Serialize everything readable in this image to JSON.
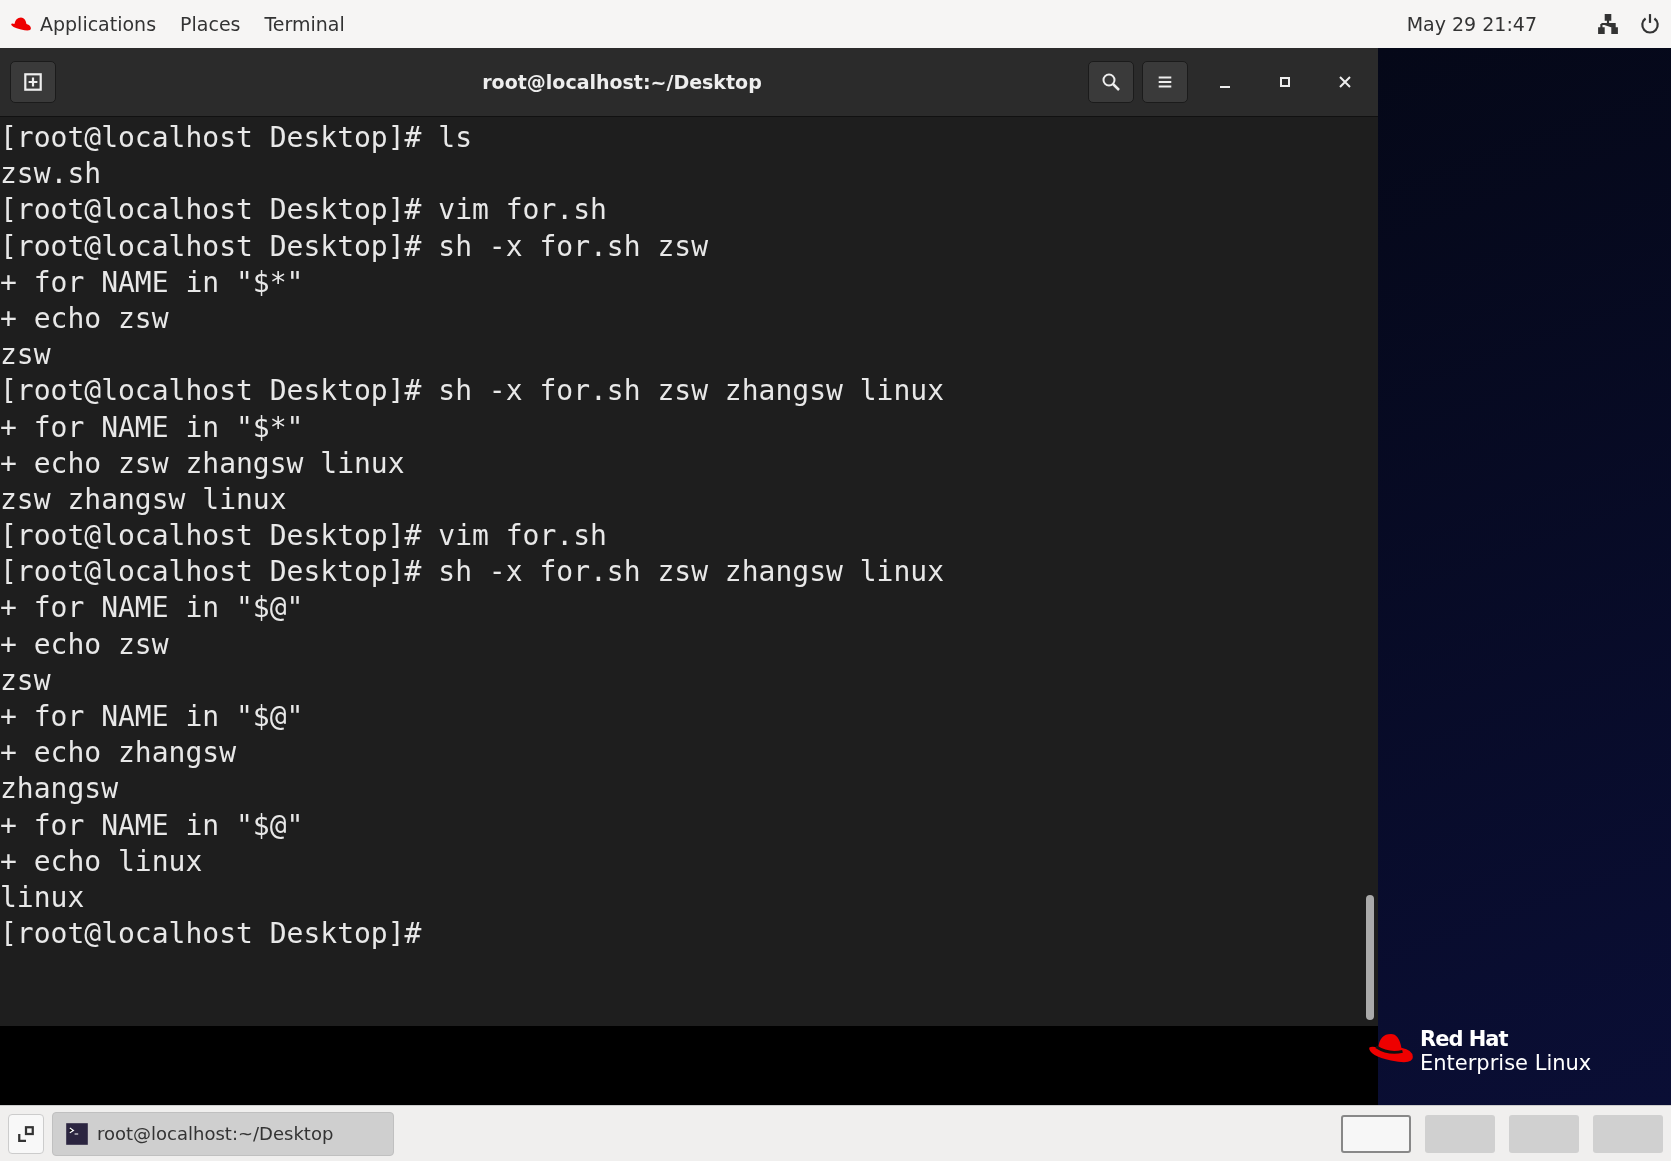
{
  "top_bar": {
    "menus": [
      "Applications",
      "Places",
      "Terminal"
    ],
    "clock": "May 29  21:47"
  },
  "terminal": {
    "title": "root@localhost:~/Desktop",
    "lines": [
      "[root@localhost Desktop]# ls",
      "zsw.sh",
      "[root@localhost Desktop]# vim for.sh",
      "[root@localhost Desktop]# sh -x for.sh zsw",
      "+ for NAME in \"$*\"",
      "+ echo zsw",
      "zsw",
      "[root@localhost Desktop]# sh -x for.sh zsw zhangsw linux",
      "+ for NAME in \"$*\"",
      "+ echo zsw zhangsw linux",
      "zsw zhangsw linux",
      "[root@localhost Desktop]# vim for.sh",
      "[root@localhost Desktop]# sh -x for.sh zsw zhangsw linux",
      "+ for NAME in \"$@\"",
      "+ echo zsw",
      "zsw",
      "+ for NAME in \"$@\"",
      "+ echo zhangsw",
      "zhangsw",
      "+ for NAME in \"$@\"",
      "+ echo linux",
      "linux",
      "[root@localhost Desktop]#"
    ]
  },
  "desktop_logo": {
    "brand": "Red Hat",
    "product": "Enterprise Linux"
  },
  "taskbar": {
    "window_button": "root@localhost:~/Desktop",
    "workspaces": [
      {
        "selected": true
      },
      {
        "selected": false
      },
      {
        "selected": false
      },
      {
        "selected": false
      }
    ]
  }
}
